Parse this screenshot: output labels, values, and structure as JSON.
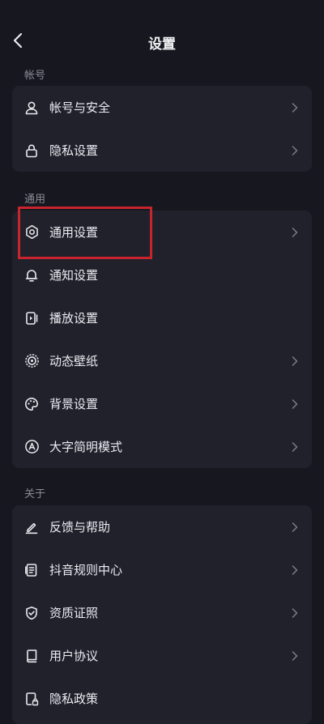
{
  "header": {
    "title": "设置",
    "back_icon": "back-arrow-icon"
  },
  "sections": [
    {
      "label": "帐号",
      "items": [
        {
          "label": "帐号与安全",
          "icon": "person-icon",
          "chevron": true
        },
        {
          "label": "隐私设置",
          "icon": "lock-icon",
          "chevron": true
        }
      ]
    },
    {
      "label": "通用",
      "items": [
        {
          "label": "通用设置",
          "icon": "gear-icon",
          "chevron": true
        },
        {
          "label": "通知设置",
          "icon": "bell-icon",
          "chevron": false
        },
        {
          "label": "播放设置",
          "icon": "play-card-icon",
          "chevron": false
        },
        {
          "label": "动态壁纸",
          "icon": "wallpaper-icon",
          "chevron": true
        },
        {
          "label": "背景设置",
          "icon": "palette-icon",
          "chevron": true
        },
        {
          "label": "大字简明模式",
          "icon": "font-a-icon",
          "chevron": true
        }
      ]
    },
    {
      "label": "关于",
      "items": [
        {
          "label": "反馈与帮助",
          "icon": "pencil-icon",
          "chevron": true
        },
        {
          "label": "抖音规则中心",
          "icon": "document-icon",
          "chevron": true
        },
        {
          "label": "资质证照",
          "icon": "shield-check-icon",
          "chevron": true
        },
        {
          "label": "用户协议",
          "icon": "book-icon",
          "chevron": true
        },
        {
          "label": "隐私政策",
          "icon": "lock-document-icon",
          "chevron": false
        }
      ]
    }
  ],
  "colors": {
    "background": "#16171f",
    "card": "#20212b",
    "highlight": "#c8242d"
  }
}
